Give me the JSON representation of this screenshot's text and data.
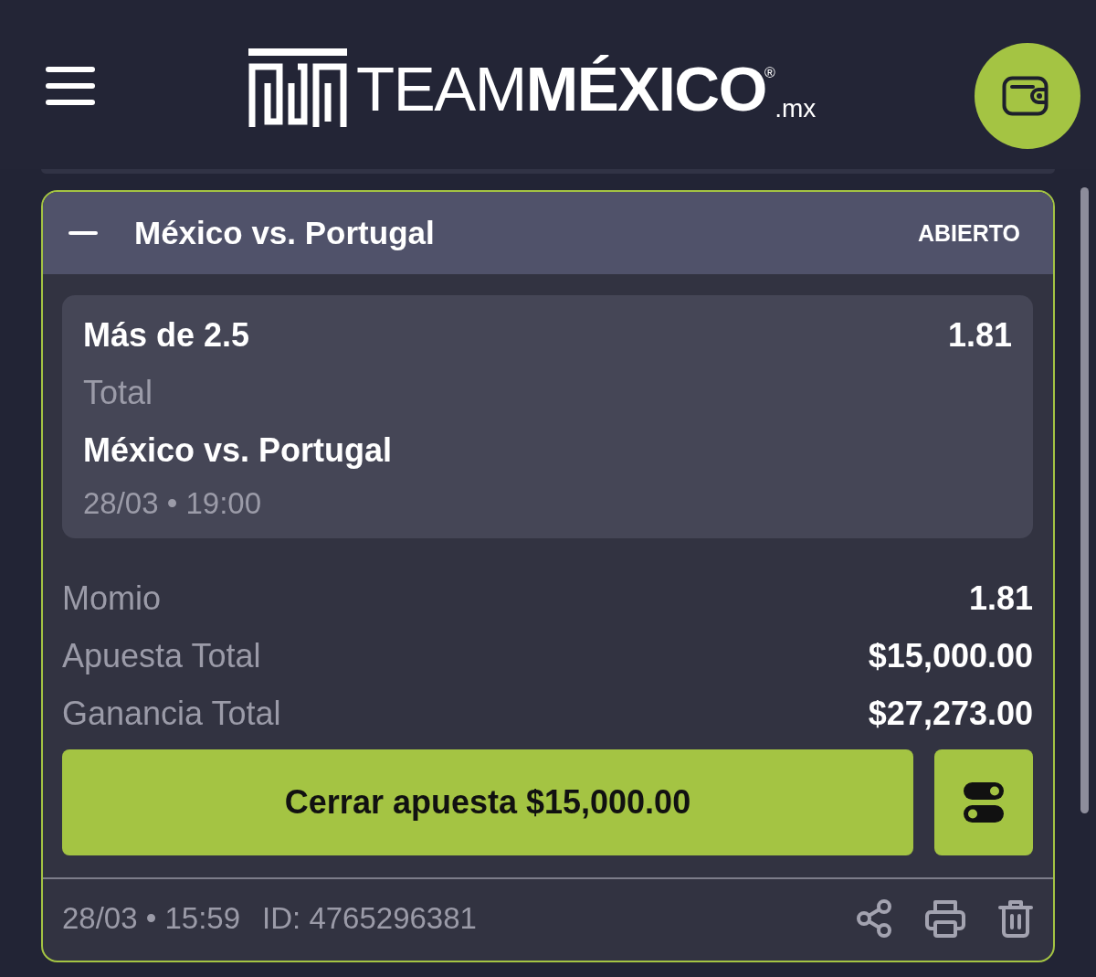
{
  "header": {
    "wordmark": "TEAM**MÉXICO**$^{®}$",
    "domain": ".mx"
  },
  "bet": {
    "title": "México vs. Portugal",
    "status": "ABIERTO",
    "expanded": true,
    "selection": {
      "market": "Más de 2.5",
      "odds": "1.81",
      "market_type": "Total",
      "event": "México vs. Portugal",
      "datetime": "28/03 • 19:00"
    },
    "summary": [
      {
        "label": "Momio",
        "value": "1.81"
      },
      {
        "label": "Apuesta Total",
        "value": "$15,000.00"
      },
      {
        "label": "Ganancia Total",
        "value": "$27,273.00"
      }
    ],
    "cashout_button": "Cerrar apuesta $15,000.00",
    "footer": {
      "placed": "28/03 • 15:59",
      "bet_id": "ID: 4765296381"
    }
  }
}
